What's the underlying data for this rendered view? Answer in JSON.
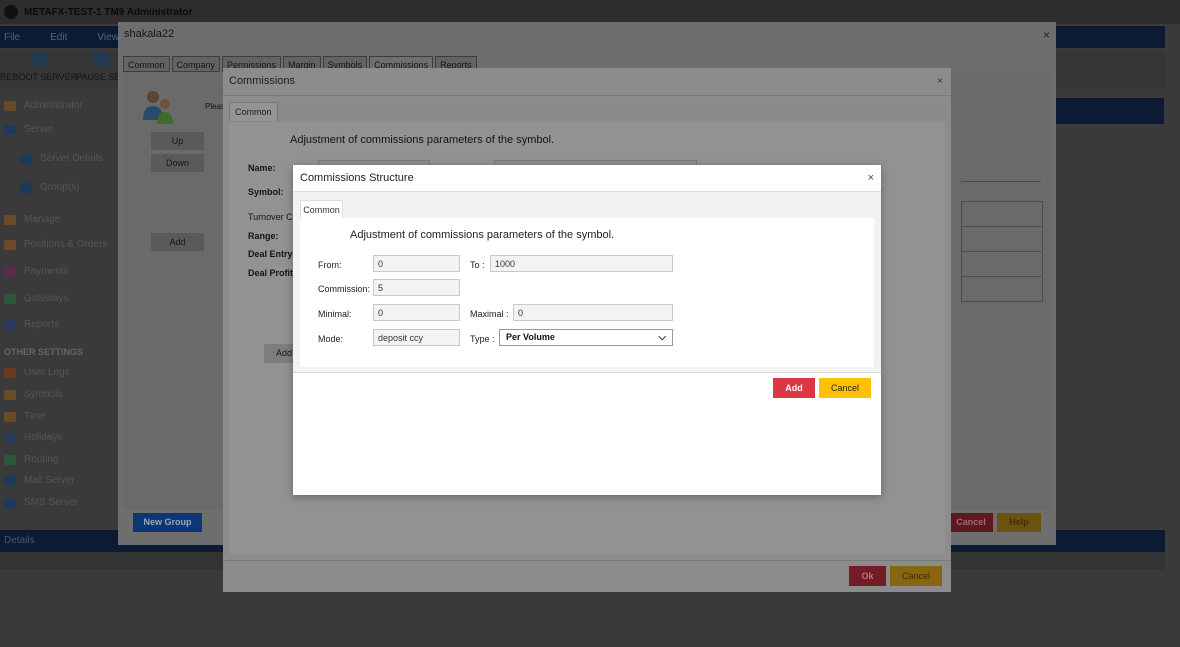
{
  "app": {
    "title": "METAFX-TEST-1 TM9 Administrator",
    "menu": [
      "File",
      "Edit",
      "View"
    ],
    "toolbar": {
      "reboot_label": "REBOOT SERVER",
      "pause_label": "PAUSE SER"
    },
    "sidebar": {
      "items": [
        "Administrator",
        "Server",
        "Server Details",
        "Group(s)",
        "Manage",
        "Positions & Orders",
        "Payments",
        "Gateways",
        "Reports"
      ],
      "other_settings_heading": "OTHER SETTINGS",
      "other_items": [
        "User Logs",
        "Symbols",
        "Time",
        "Holidays",
        "Routing",
        "Mail Server",
        "SMS Server"
      ]
    },
    "details_label": "Details"
  },
  "group_dialog": {
    "title": "shakala22",
    "tabs": [
      "Common",
      "Company",
      "Permissions",
      "Margin",
      "Symbols",
      "Commissions",
      "Reports"
    ],
    "please_text": "Please",
    "up_label": "Up",
    "down_label": "Down",
    "add_label": "Add",
    "new_group_label": "New Group",
    "cancel_label": "Cancel",
    "help_label": "Help"
  },
  "commissions_dialog": {
    "title": "Commissions",
    "tab": "Common",
    "heading": "Adjustment of commissions parameters of the symbol.",
    "labels": {
      "name": "Name:",
      "symbol": "Symbol:",
      "turnover": "Turnover Cu",
      "range": "Range:",
      "deal_entry": "Deal Entry:",
      "deal_profit": "Deal Profit:"
    },
    "add_label": "Add",
    "ok_label": "Ok",
    "cancel_label": "Cancel"
  },
  "structure_dialog": {
    "title": "Commissions Structure",
    "tab": "Common",
    "heading": "Adjustment of commissions parameters of the symbol.",
    "from_label": "From:",
    "from_value": "0",
    "to_label": "To :",
    "to_value": "1000",
    "commission_label": "Commission:",
    "commission_value": "5",
    "minimal_label": "Minimal:",
    "minimal_value": "0",
    "maximal_label": "Maximal :",
    "maximal_value": "0",
    "mode_label": "Mode:",
    "mode_value": "deposit ccy",
    "type_label": "Type :",
    "type_value": "Per Volume",
    "add_label": "Add",
    "cancel_label": "Cancel",
    "colors": {
      "add": "#dc3545",
      "cancel": "#ffc107",
      "new_group": "#0d6efd"
    }
  }
}
